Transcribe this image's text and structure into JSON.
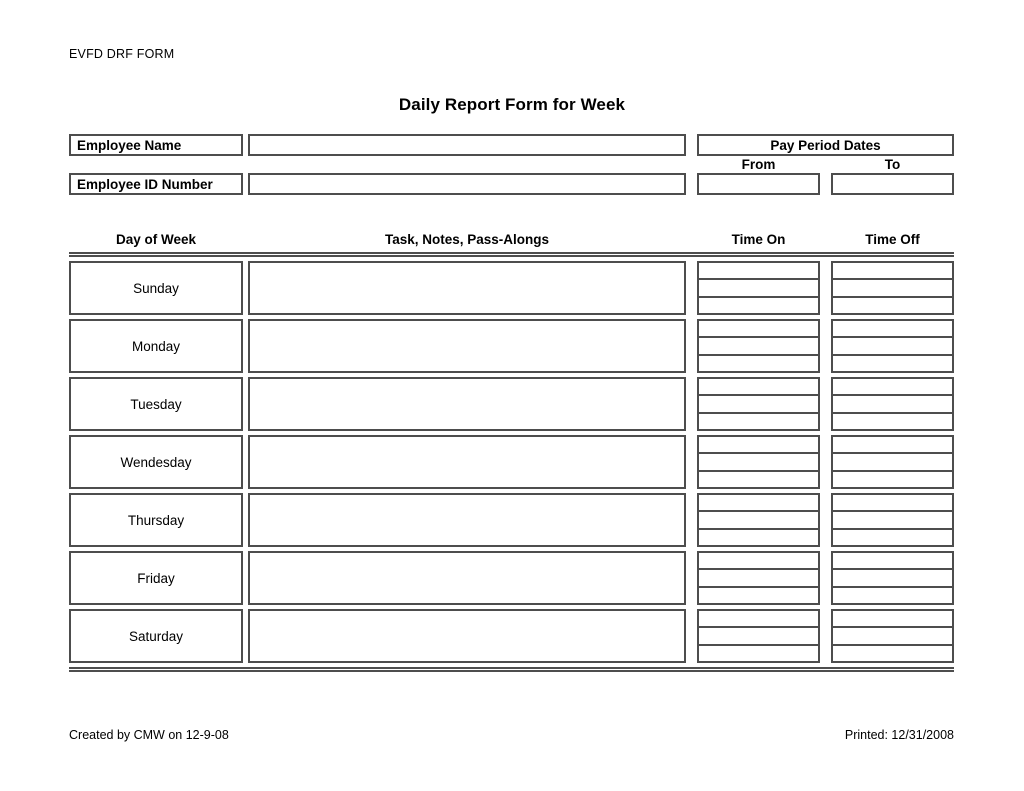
{
  "document": {
    "form_code": "EVFD DRF FORM",
    "title": "Daily Report Form for Week"
  },
  "identity": {
    "employee_name_label": "Employee Name",
    "employee_name_value": "",
    "employee_id_label": "Employee ID Number",
    "employee_id_value": ""
  },
  "pay_period": {
    "header": "Pay Period Dates",
    "from_label": "From",
    "to_label": "To",
    "from_value": "",
    "to_value": ""
  },
  "table": {
    "columns": {
      "day": "Day of Week",
      "task": "Task, Notes, Pass-Alongs",
      "time_on": "Time On",
      "time_off": "Time Off"
    },
    "sublines_per_time_cell": 3,
    "rows": [
      {
        "day": "Sunday",
        "task": "",
        "time_on": [
          "",
          "",
          ""
        ],
        "time_off": [
          "",
          "",
          ""
        ]
      },
      {
        "day": "Monday",
        "task": "",
        "time_on": [
          "",
          "",
          ""
        ],
        "time_off": [
          "",
          "",
          ""
        ]
      },
      {
        "day": "Tuesday",
        "task": "",
        "time_on": [
          "",
          "",
          ""
        ],
        "time_off": [
          "",
          "",
          ""
        ]
      },
      {
        "day": "Wendesday",
        "task": "",
        "time_on": [
          "",
          "",
          ""
        ],
        "time_off": [
          "",
          "",
          ""
        ]
      },
      {
        "day": "Thursday",
        "task": "",
        "time_on": [
          "",
          "",
          ""
        ],
        "time_off": [
          "",
          "",
          ""
        ]
      },
      {
        "day": "Friday",
        "task": "",
        "time_on": [
          "",
          "",
          ""
        ],
        "time_off": [
          "",
          "",
          ""
        ]
      },
      {
        "day": "Saturday",
        "task": "",
        "time_on": [
          "",
          "",
          ""
        ],
        "time_off": [
          "",
          "",
          ""
        ]
      }
    ]
  },
  "footer": {
    "created": "Created by CMW on 12-9-08",
    "printed": "Printed: 12/31/2008"
  },
  "colors": {
    "border": "#4d4d4d",
    "text": "#000000",
    "background": "#ffffff"
  }
}
